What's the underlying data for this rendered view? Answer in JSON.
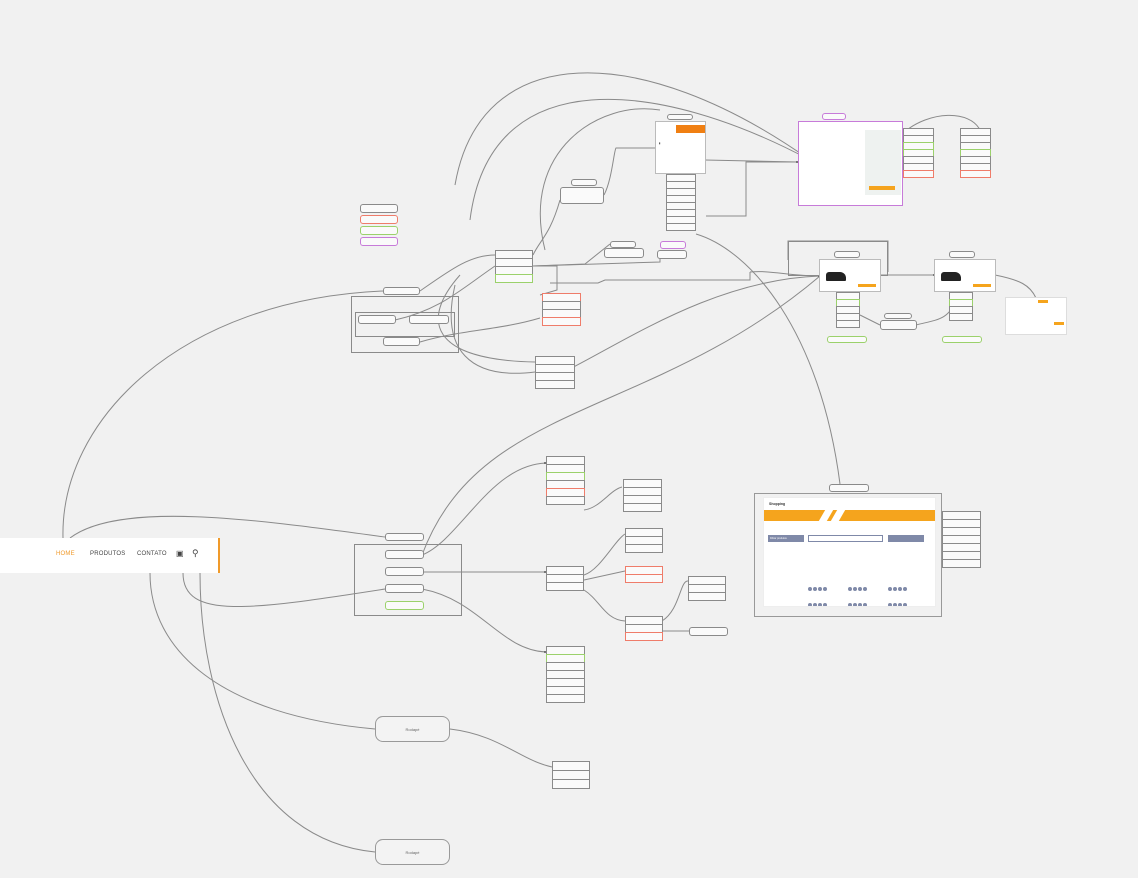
{
  "navbar": {
    "home": "HOME",
    "products": "PRODUTOS",
    "contact": "CONTATO",
    "accent": "#f09a2a"
  },
  "big_nodes": {
    "lower_1": "Rodapé",
    "lower_2": "Rodapé"
  },
  "showcase": {
    "logo": "Shopping",
    "filter_title": "Filtrar produtos"
  },
  "colors": {
    "background": "#f1f1f1",
    "wire": "#8a8a8a",
    "green": "#9bd16b",
    "red": "#ef7c6a",
    "purple": "#c77bd9",
    "orange": "#f5a41d"
  }
}
